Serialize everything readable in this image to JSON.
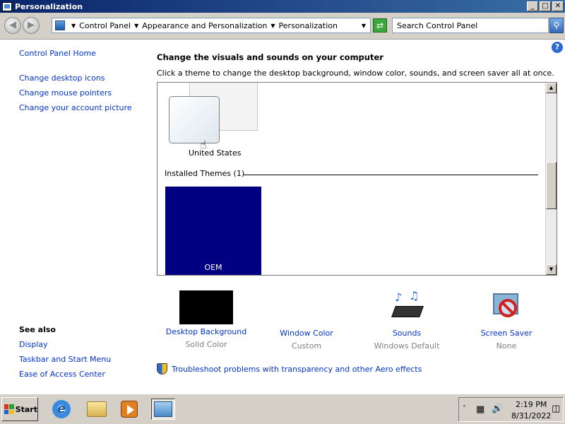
{
  "window": {
    "title": "Personalization",
    "buttons": [
      "_",
      "□",
      "✕"
    ]
  },
  "address": {
    "crumbs": [
      "Control Panel",
      "Appearance and Personalization",
      "Personalization"
    ],
    "search_placeholder": "Search Control Panel"
  },
  "help_glyph": "?",
  "left_nav": {
    "home": "Control Panel Home",
    "items": [
      "Change desktop icons",
      "Change mouse pointers",
      "Change your account picture"
    ]
  },
  "see_also": {
    "title": "See also",
    "items": [
      "Display",
      "Taskbar and Start Menu",
      "Ease of Access Center"
    ]
  },
  "main": {
    "heading": "Change the visuals and sounds on your computer",
    "subheading": "Click a theme to change the desktop background, window color, sounds, and screen saver all at once.",
    "my_theme_label": "United States",
    "installed_header": "Installed Themes (1)",
    "installed_theme_label": "OEM",
    "installed_theme_color": "#000080"
  },
  "options": [
    {
      "label": "Desktop Background",
      "value": "Solid Color",
      "icon": "desktop-background-swatch"
    },
    {
      "label": "Window Color",
      "value": "Custom",
      "icon": "window-color-swatch"
    },
    {
      "label": "Sounds",
      "value": "Windows Default",
      "icon": "sounds-icon"
    },
    {
      "label": "Screen Saver",
      "value": "None",
      "icon": "screen-saver-icon"
    }
  ],
  "troubleshoot_link": "Troubleshoot problems with transparency and other Aero effects",
  "taskbar": {
    "start_label": "Start",
    "apps": [
      "internet-explorer-icon",
      "file-explorer-icon",
      "media-player-icon",
      "control-panel-icon"
    ],
    "time": "2:19 PM",
    "date": "8/31/2022"
  }
}
